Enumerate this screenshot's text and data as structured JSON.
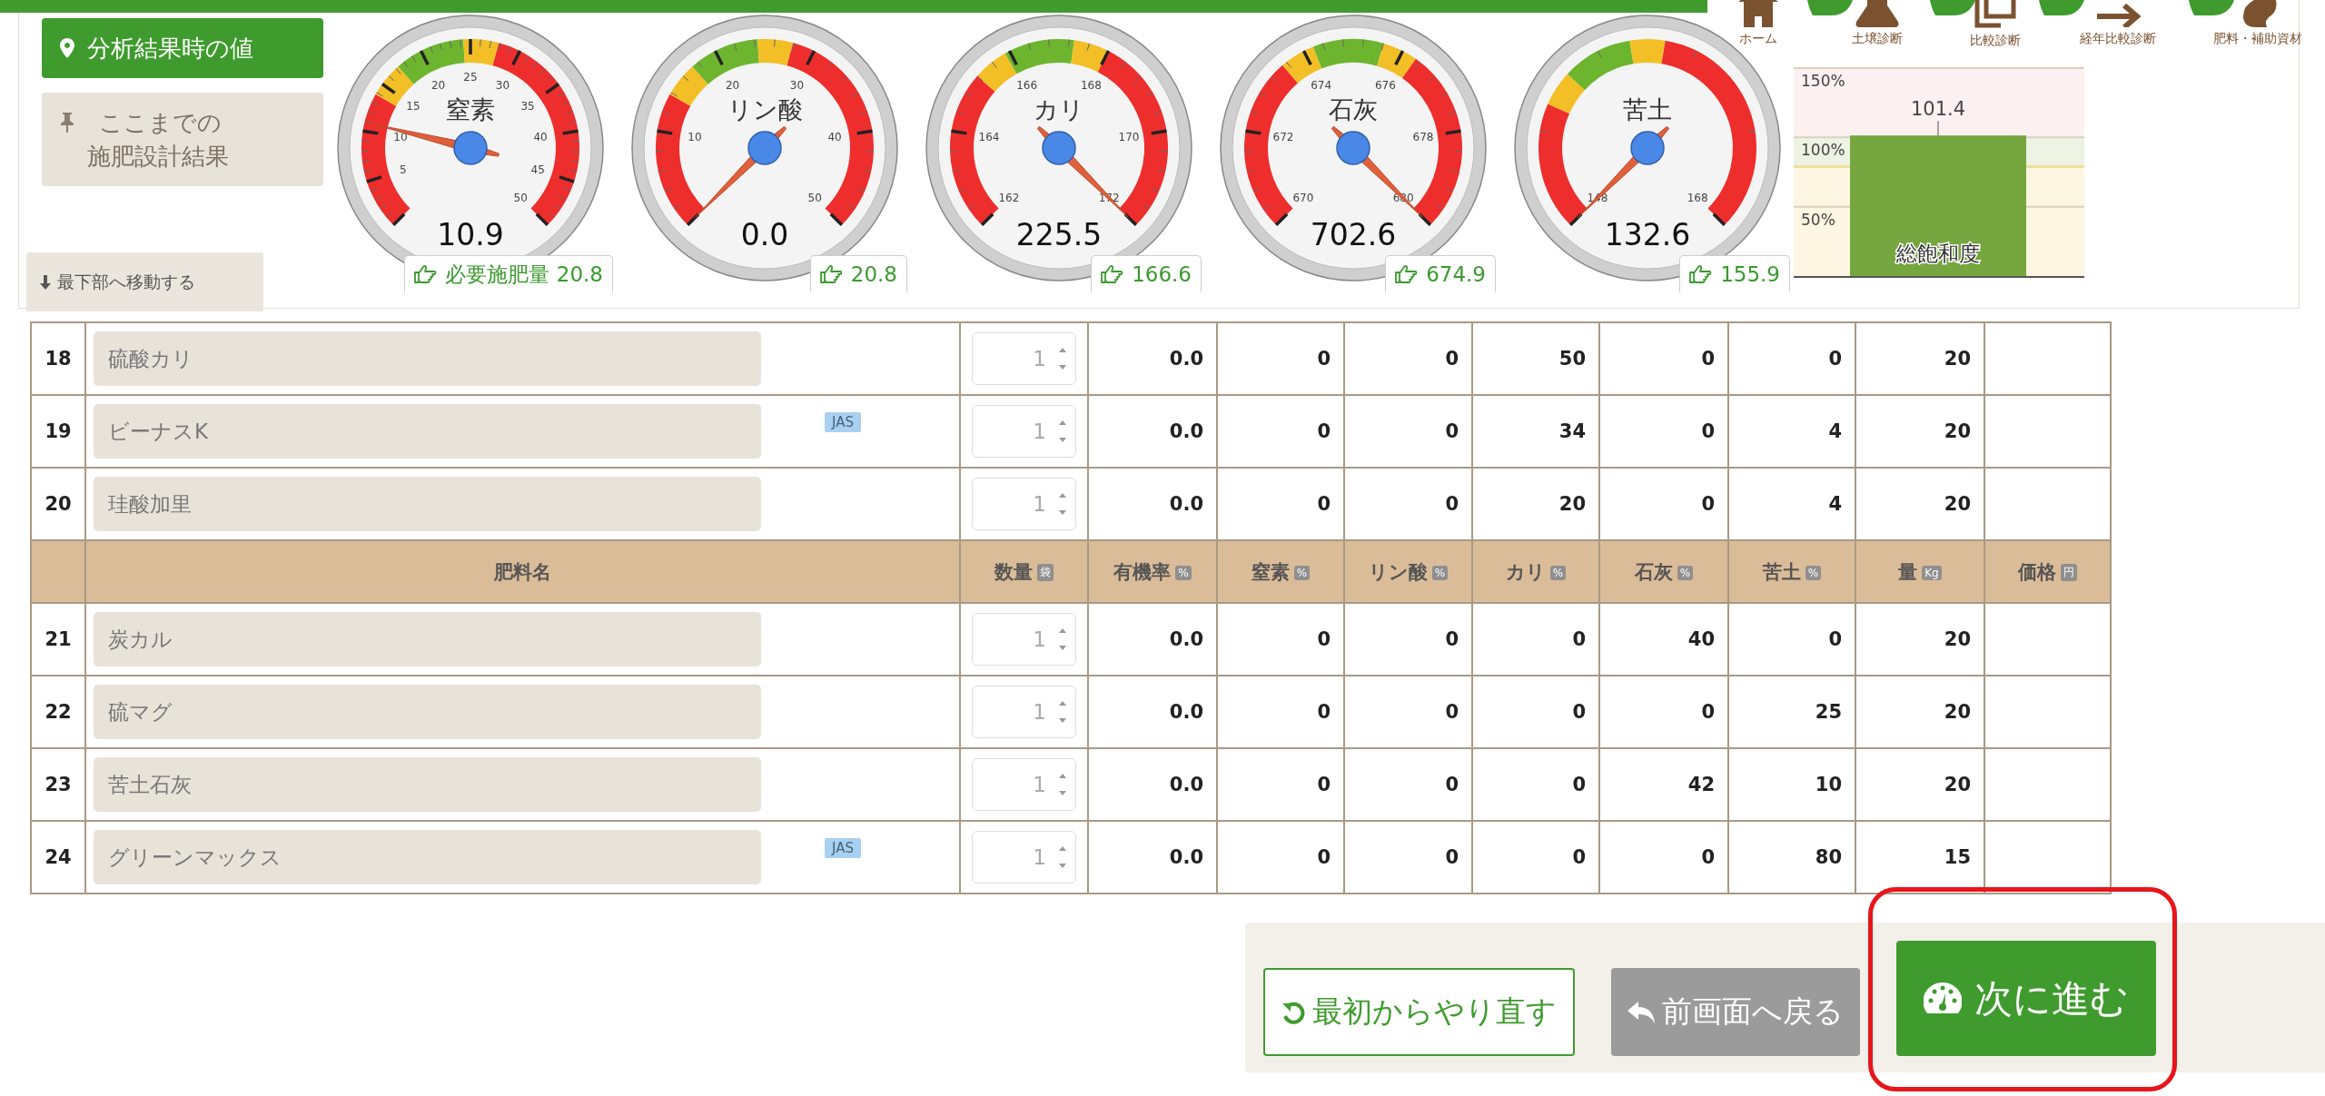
{
  "nav": [
    {
      "kind": "house",
      "label": "ホーム"
    },
    {
      "kind": "flask",
      "label": "土壌診断"
    },
    {
      "kind": "copy",
      "label": "比較診断"
    },
    {
      "kind": "arrow",
      "label": "経年比較診断"
    },
    {
      "kind": "bag",
      "label": "肥料・補助資材"
    }
  ],
  "view_tabs": [
    {
      "kind": "pin",
      "label": "分析結果時の値",
      "selected": true
    },
    {
      "kind": "pushpin",
      "label": "ここまでの施肥設計結果",
      "selected": false
    }
  ],
  "scroll_button": {
    "label": "最下部へ移動する"
  },
  "gauges": [
    {
      "title": "窒素",
      "value": "10.9",
      "ticks": [
        "5",
        "10",
        "15",
        "20",
        "25",
        "30",
        "35",
        "40",
        "45",
        "50"
      ],
      "start_labeled": false,
      "zones": [
        {
          "color": "#ee2d2d"
        },
        {
          "color": "#f2bf26"
        },
        {
          "color": "#6eb52f"
        },
        {
          "color": "#f2bf26"
        },
        {
          "color": "#ee2d2d"
        }
      ],
      "recommend_label": "必要施肥量",
      "recommend": "20.8"
    },
    {
      "title": "リン酸",
      "value": "0.0",
      "ticks": [
        "10",
        "20",
        "30",
        "40",
        "50"
      ],
      "start_labeled": false,
      "zones": [
        {
          "color": "#ee2d2d"
        },
        {
          "color": "#f2bf26"
        },
        {
          "color": "#6eb52f"
        },
        {
          "color": "#f2bf26"
        },
        {
          "color": "#ee2d2d"
        }
      ],
      "recommend": "20.8"
    },
    {
      "title": "カリ",
      "value": "225.5",
      "ticks": [
        "162",
        "164",
        "166",
        "168",
        "170",
        "172"
      ],
      "start_labeled": true,
      "zones": [
        {
          "color": "#ee2d2d"
        },
        {
          "color": "#f2bf26"
        },
        {
          "color": "#6eb52f"
        },
        {
          "color": "#f2bf26"
        },
        {
          "color": "#ee2d2d"
        }
      ],
      "recommend": "166.6"
    },
    {
      "title": "石灰",
      "value": "702.6",
      "ticks": [
        "670",
        "672",
        "674",
        "676",
        "678",
        "680"
      ],
      "start_labeled": true,
      "zones": [
        {
          "color": "#ee2d2d"
        },
        {
          "color": "#f2bf26"
        },
        {
          "color": "#6eb52f"
        },
        {
          "color": "#f2bf26"
        },
        {
          "color": "#ee2d2d"
        }
      ],
      "recommend": "674.9"
    },
    {
      "title": "苦土",
      "value": "132.6",
      "ticks": [
        "148",
        "168"
      ],
      "start_labeled": true,
      "zones": [
        {
          "color": "#ee2d2d"
        },
        {
          "color": "#f2bf26"
        },
        {
          "color": "#6eb52f"
        },
        {
          "color": "#f2bf26"
        },
        {
          "color": "#ee2d2d"
        }
      ],
      "recommend": "155.9"
    }
  ],
  "saturation_chart": {
    "chart_data": {
      "type": "bar",
      "categories": [
        "総飽和度"
      ],
      "values": [
        101.4
      ],
      "ylim": [
        0,
        150
      ],
      "yticks": [
        {
          "value": 50,
          "label": "50%"
        },
        {
          "value": 100,
          "label": "100%"
        },
        {
          "value": 150,
          "label": "150%"
        }
      ],
      "data_labels": true
    }
  },
  "table": {
    "columns": [
      {
        "label": "肥料名"
      },
      {
        "label": "数量",
        "unit": "袋"
      },
      {
        "label": "有機率",
        "unit": "%"
      },
      {
        "label": "窒素",
        "unit": "%"
      },
      {
        "label": "リン酸",
        "unit": "%"
      },
      {
        "label": "カリ",
        "unit": "%"
      },
      {
        "label": "石灰",
        "unit": "%"
      },
      {
        "label": "苦土",
        "unit": "%"
      },
      {
        "label": "量",
        "unit": "Kg"
      },
      {
        "label": "価格",
        "unit": "円"
      }
    ],
    "rows": [
      {
        "kind": "item",
        "no": "18",
        "name": "硫酸カリ",
        "quantity": "1",
        "values": [
          "0.0",
          "0",
          "0",
          "50",
          "0",
          "0",
          "20"
        ]
      },
      {
        "kind": "item",
        "no": "19",
        "name": "ビーナスK",
        "tag": "JAS",
        "quantity": "1",
        "values": [
          "0.0",
          "0",
          "0",
          "34",
          "0",
          "4",
          "20"
        ]
      },
      {
        "kind": "item",
        "no": "20",
        "name": "珪酸加里",
        "quantity": "1",
        "values": [
          "0.0",
          "0",
          "0",
          "20",
          "0",
          "4",
          "20"
        ]
      },
      {
        "kind": "header"
      },
      {
        "kind": "item",
        "no": "21",
        "name": "炭カル",
        "quantity": "1",
        "values": [
          "0.0",
          "0",
          "0",
          "0",
          "40",
          "0",
          "20"
        ]
      },
      {
        "kind": "item",
        "no": "22",
        "name": "硫マグ",
        "quantity": "1",
        "values": [
          "0.0",
          "0",
          "0",
          "0",
          "0",
          "25",
          "20"
        ]
      },
      {
        "kind": "item",
        "no": "23",
        "name": "苦土石灰",
        "quantity": "1",
        "values": [
          "0.0",
          "0",
          "0",
          "0",
          "42",
          "10",
          "20"
        ]
      },
      {
        "kind": "item",
        "no": "24",
        "name": "グリーンマックス",
        "tag": "JAS",
        "quantity": "1",
        "values": [
          "0.0",
          "0",
          "0",
          "0",
          "0",
          "80",
          "15"
        ]
      }
    ]
  },
  "actions": [
    {
      "kind": "restart",
      "label": "最初からやり直す",
      "highlighted": false
    },
    {
      "kind": "back",
      "label": "前画面へ戻る",
      "highlighted": false
    },
    {
      "kind": "next",
      "label": "次に進む",
      "highlighted": true
    }
  ]
}
